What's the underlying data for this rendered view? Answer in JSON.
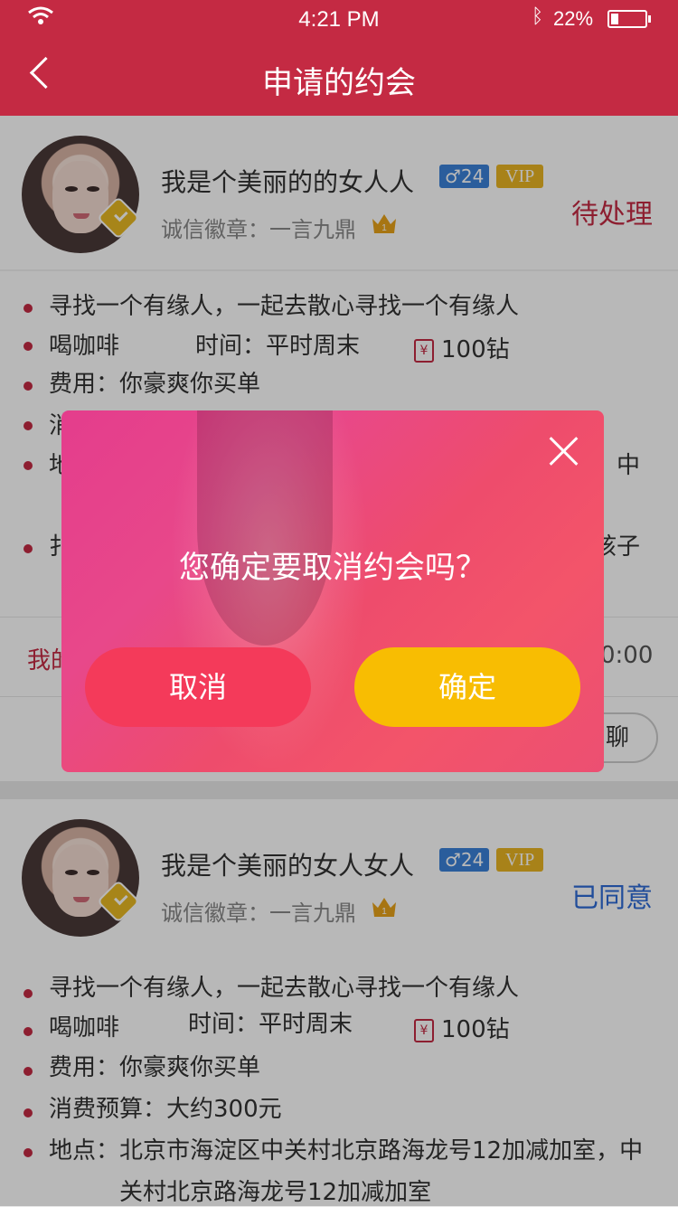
{
  "status_bar": {
    "time": "4:21 PM",
    "battery": "22%",
    "battery_level": 0.22
  },
  "nav": {
    "title": "申请的约会"
  },
  "cards": [
    {
      "name": "我是个美丽的的女人人",
      "gender_age": "♂24",
      "vip": "VIP",
      "badge_text": "诚信徽章：一言九鼎",
      "crown_num": "1",
      "status": "待处理",
      "status_color": "#c42a43",
      "lines": {
        "purpose": "寻找一个有缘人，一起去散心寻找一个有缘人",
        "activity": "喝咖啡",
        "time": "时间：平时周末",
        "coins": "100钻",
        "fee": "费用：你豪爽你买单",
        "budget_partial": "消",
        "location_partial": "地",
        "location_tail": "，中",
        "other_partial": "扌",
        "other_tail": "孩子"
      },
      "footer": {
        "my_partial": "我的",
        "time_tail": "0:00",
        "chat_partial": "聊"
      }
    },
    {
      "name": "我是个美丽的女人女人",
      "gender_age": "♂24",
      "vip": "VIP",
      "badge_text": "诚信徽章：一言九鼎",
      "crown_num": "1",
      "status": "已同意",
      "status_color": "#2f6bd6",
      "lines": {
        "purpose": "寻找一个有缘人，一起去散心寻找一个有缘人",
        "activity": "喝咖啡",
        "time": "时间：平时周末",
        "coins": "100钻",
        "fee": "费用：你豪爽你买单",
        "budget": "消费预算：大约300元",
        "location": "地点：北京市海淀区中关村北京路海龙号12加减加室，中",
        "location2": "关村北京路海龙号12加减加室"
      }
    }
  ],
  "dialog": {
    "message": "您确定要取消约会吗？",
    "cancel": "取消",
    "confirm": "确定"
  }
}
